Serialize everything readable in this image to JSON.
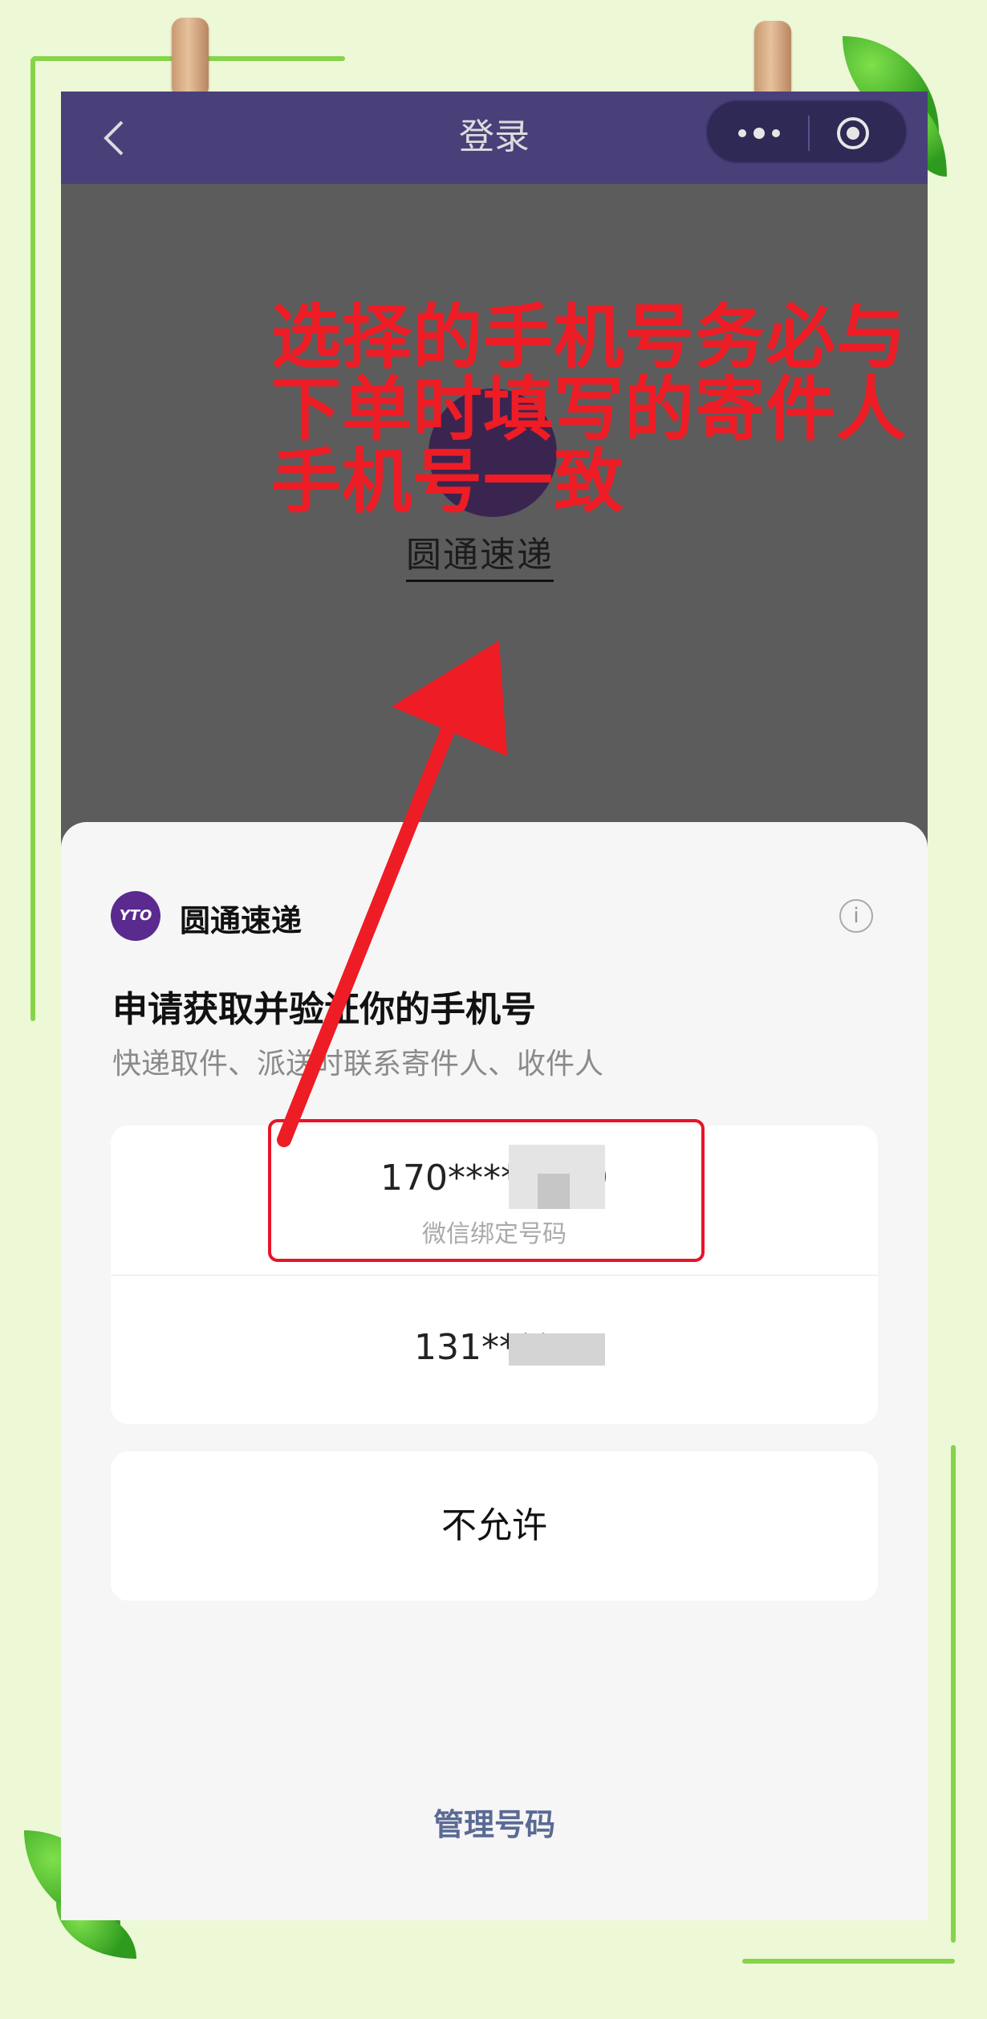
{
  "navbar": {
    "title": "登录",
    "back_icon": "chevron-left-icon",
    "more_icon": "more-dots-icon",
    "close_icon": "target-circle-icon"
  },
  "background_app": {
    "name": "圆通速递"
  },
  "annotation": {
    "lines": [
      "选择的手机号务必与",
      "下单时填写的寄件人",
      "手机号一致"
    ],
    "color": "#ee1c25"
  },
  "sheet": {
    "app_name": "圆通速递",
    "app_logo_text": "YTO",
    "info_icon": "info-icon",
    "title": "申请获取并验证你的手机号",
    "subtitle": "快递取件、派送时联系寄件人、收件人",
    "phones": [
      {
        "number": "170****6679",
        "tag": "微信绑定号码"
      },
      {
        "number": "131****4",
        "tag": ""
      }
    ],
    "deny_label": "不允许",
    "manage_label": "管理号码"
  },
  "colors": {
    "navbar": "#49407a",
    "page_bg": "#edf8d6",
    "manage_link": "#5a6a94",
    "highlight": "#e8132a"
  }
}
